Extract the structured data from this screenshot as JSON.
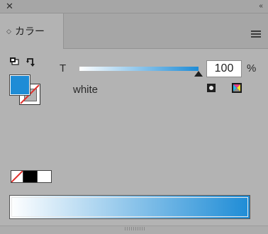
{
  "window": {
    "close_glyph": "✕",
    "collapse_glyph": "‹‹"
  },
  "tab": {
    "label": "カラー",
    "arrows_glyph": "◇"
  },
  "tint": {
    "label": "T",
    "value": "100",
    "unit": "%",
    "level": 1.0,
    "color_name": "white"
  },
  "colors": {
    "fill": "#1e8cd6",
    "ramp_start": "#ffffff",
    "ramp_end": "#1e8cd6"
  },
  "icons": {
    "close": "close-icon",
    "collapse": "collapse-icon",
    "menu": "panel-menu-icon",
    "default_colors": "default-fill-stroke-icon",
    "swap": "swap-fill-stroke-icon",
    "grayscale": "grayscale-mode-icon",
    "cmyk": "cmyk-mode-icon"
  }
}
